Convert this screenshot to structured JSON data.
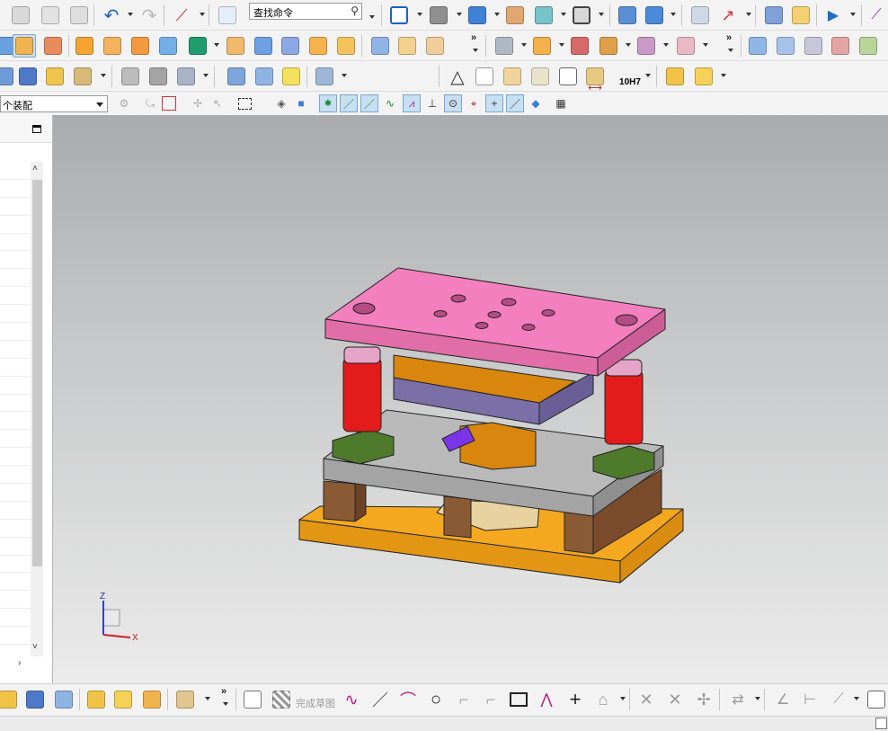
{
  "search": {
    "placeholder": "查找命令",
    "icon": "magnifier-icon"
  },
  "selection_filter": {
    "value": "个装配"
  },
  "bottom_toolbar": {
    "finish_sketch_label": "完成草图"
  },
  "toolbar_row3": {
    "fit_label": "10H7"
  },
  "overflow_marker": "»",
  "axis_triad": {
    "z_label": "Z",
    "x_label": "X"
  },
  "model_colors": {
    "top_plate": "#f47fbf",
    "guide_post": "#e41b1b",
    "guide_bushing": "#e6a3c8",
    "base_plate": "#b9b9b9",
    "post_bases": "#4d7a2b",
    "die_block": "#d9860e",
    "stripper": "#7b6fa8",
    "punch": "#7a35e8",
    "parallels": "#8a5a35",
    "bottom_plate": "#f4a81f"
  }
}
